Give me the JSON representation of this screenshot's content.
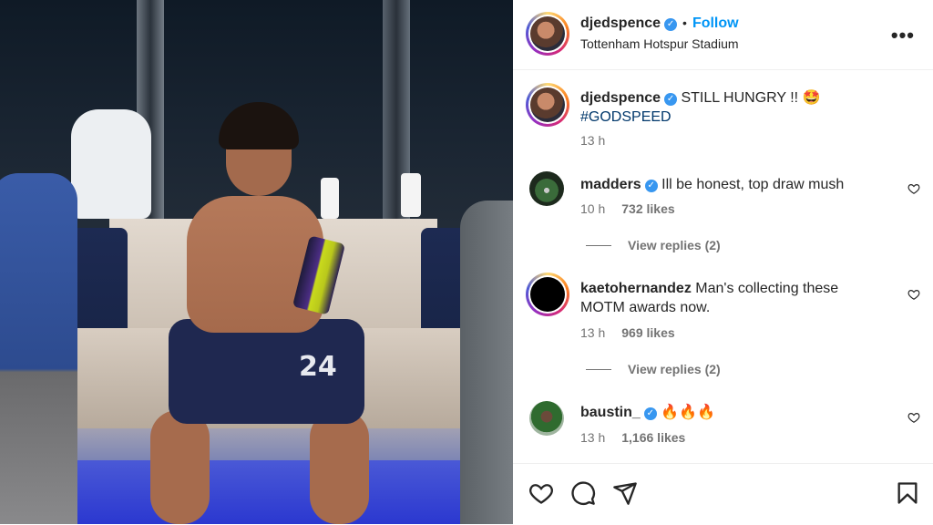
{
  "post": {
    "username": "djedspence",
    "follow_label": "Follow",
    "separator": "•",
    "location": "Tottenham Hotspur Stadium",
    "more_label": "•••",
    "caption": "STILL HUNGRY !! 🤩",
    "hashtag": "#GODSPEED",
    "caption_time": "13 h",
    "photo": {
      "shirt_number": "24",
      "description_icons": [
        "trophy-icon",
        "bottle-icon"
      ]
    }
  },
  "comments": [
    {
      "username": "madders",
      "verified": true,
      "text": "Ill be honest, top draw mush",
      "time": "10 h",
      "likes": "732 likes",
      "view_replies": "View replies (2)"
    },
    {
      "username": "kaetohernandez",
      "verified": false,
      "text": "Man's collecting these MOTM awards now.",
      "time": "13 h",
      "likes": "969 likes",
      "view_replies": "View replies (2)"
    },
    {
      "username": "baustin_",
      "verified": true,
      "text": "🔥🔥🔥",
      "time": "13 h",
      "likes": "1,166 likes"
    }
  ],
  "colors": {
    "link_blue": "#0095f6",
    "verified_blue": "#3897f0",
    "hashtag": "#00376b",
    "muted": "#737373",
    "text": "#262626"
  },
  "icons": {
    "verified": "✓",
    "actions": [
      "heart-icon",
      "comment-icon",
      "share-icon",
      "bookmark-icon"
    ]
  }
}
